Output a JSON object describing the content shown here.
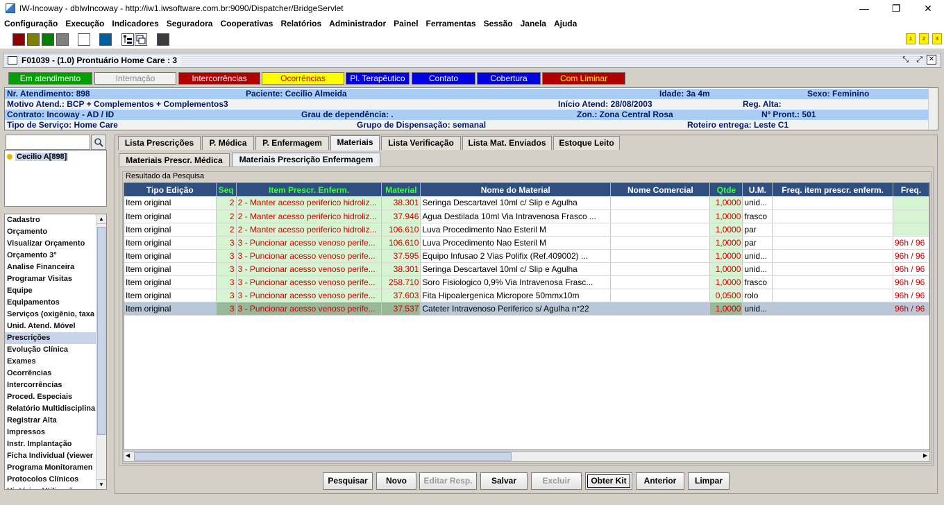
{
  "window": {
    "title": "IW-Incoway - dblwIncoway - http://iw1.iwsoftware.com.br:9090/Dispatcher/BridgeServlet",
    "min": "—",
    "max": "❐",
    "close": "✕"
  },
  "menu": [
    "Configuração",
    "Execução",
    "Indicadores",
    "Seguradora",
    "Cooperativas",
    "Relatórios",
    "Administrador",
    "Painel",
    "Ferramentas",
    "Sessão",
    "Janela",
    "Ajuda"
  ],
  "toolbar": {
    "colors": [
      "#8b0000",
      "#7f7f00",
      "#007f00",
      "#7f7f7f",
      "#ffffff",
      "#005f9f",
      "#3c3c3c"
    ],
    "right_buttons": [
      "1",
      "2",
      "3"
    ]
  },
  "frame": {
    "title": "F01039 - (1.0) Prontuário Home Care : 3"
  },
  "status_buttons": [
    {
      "label": "Em atendimento",
      "bg": "#00a000",
      "fg": "#ffffff"
    },
    {
      "label": "Internação",
      "bg": "#f0f0f0",
      "fg": "#8a8a8a"
    },
    {
      "label": "Intercorrências",
      "bg": "#b00000",
      "fg": "#ffffff"
    },
    {
      "label": "Ocorrências",
      "bg": "#ffff00",
      "fg": "#cc0000"
    },
    {
      "label": "Pl. Terapêutico",
      "bg": "#0000e0",
      "fg": "#ffffff"
    },
    {
      "label": "Contato",
      "bg": "#0000e0",
      "fg": "#ffffff"
    },
    {
      "label": "Cobertura",
      "bg": "#0000e0",
      "fg": "#ffffff"
    },
    {
      "label": "Com Liminar",
      "bg": "#b00000",
      "fg": "#ffff00"
    }
  ],
  "info": {
    "nr_label": "Nr. Atendimento:",
    "nr": "898",
    "paciente_label": "Paciente:",
    "paciente": "Cecilio Almeida",
    "idade_label": "Idade:",
    "idade": "3a 4m",
    "sexo_label": "Sexo:",
    "sexo": "Feminino",
    "motivo_label": "Motivo Atend.:",
    "motivo": "BCP + Complementos + Complementos3",
    "inicio_label": "Início Atend:",
    "inicio": "28/08/2003",
    "alta_label": "Reg. Alta:",
    "alta": "",
    "contrato_label": "Contrato:",
    "contrato": "Incoway - AD / ID",
    "grau_label": "Grau de dependência:",
    "grau": ".",
    "zon_label": "Zon.:",
    "zon": "Zona Central Rosa",
    "pront_label": "Nº Pront.:",
    "pront": "501",
    "tipo_label": "Tipo de Serviço:",
    "tipo": "Home Care",
    "grupo_label": "Grupo de Dispensação:",
    "grupo": "semanal",
    "roteiro_label": "Roteiro entrega:",
    "roteiro": "Leste C1"
  },
  "tree": {
    "item": "Cecilio A[898]"
  },
  "nav": [
    "Cadastro",
    "Orçamento",
    "Visualizar Orçamento",
    "Orçamento 3°",
    "Analise Financeira",
    "Programar Visitas",
    "Equipe",
    "Equipamentos",
    "Serviços (oxigênio, taxa",
    "Unid. Atend. Móvel",
    "Prescrições",
    "Evolução Clínica",
    "Exames",
    "Ocorrências",
    "Intercorrências",
    "Proced. Especiais",
    "Relatório Multidisciplina",
    "Registrar Alta",
    "Impressos",
    "Instr. Implantação",
    "Ficha Individual (viewer",
    "Programa Monitoramen",
    "Protocolos Clínicos",
    "Histórico Utilização"
  ],
  "tabs": [
    "Lista Prescrições",
    "P. Médica",
    "P. Enfermagem",
    "Materiais",
    "Lista Verificação",
    "Lista Mat. Enviados",
    "Estoque Leito"
  ],
  "subtabs": [
    "Materiais Prescr. Médica",
    "Materiais Prescrição Enfermagem"
  ],
  "result_label": "Resultado da Pesquisa",
  "columns": [
    "Tipo Edição",
    "Seq",
    "Item Prescr. Enferm.",
    "Material",
    "Nome do Material",
    "Nome Comercial",
    "Qtde",
    "U.M.",
    "Freq. item prescr. enferm.",
    "Freq."
  ],
  "rows": [
    [
      "Item original",
      "2",
      "2 - Manter acesso periferico hidroliz...",
      "38.301",
      "Seringa Descartavel 10ml c/ Slip e Agulha",
      "",
      "1,0000",
      "unid...",
      "",
      ""
    ],
    [
      "Item original",
      "2",
      "2 - Manter acesso periferico hidroliz...",
      "37.946",
      "Agua Destilada  10ml  Via Intravenosa  Frasco ...",
      "",
      "1,0000",
      "frasco",
      "",
      ""
    ],
    [
      "Item original",
      "2",
      "2 - Manter acesso periferico hidroliz...",
      "106.610",
      "Luva Procedimento Nao Esteril M",
      "",
      "1,0000",
      "par",
      "",
      ""
    ],
    [
      "Item original",
      "3",
      "3 - Puncionar acesso venoso perife...",
      "106.610",
      "Luva Procedimento Nao Esteril M",
      "",
      "1,0000",
      "par",
      "",
      "96h / 96"
    ],
    [
      "Item original",
      "3",
      "3 - Puncionar acesso venoso perife...",
      "37.595",
      "Equipo Infusao 2 Vias Polifix (Ref.409002)         ...",
      "",
      "1,0000",
      "unid...",
      "",
      "96h / 96"
    ],
    [
      "Item original",
      "3",
      "3 - Puncionar acesso venoso perife...",
      "38.301",
      "Seringa Descartavel 10ml c/ Slip e Agulha",
      "",
      "1,0000",
      "unid...",
      "",
      "96h / 96"
    ],
    [
      "Item original",
      "3",
      "3 - Puncionar acesso venoso perife...",
      "258.710",
      "Soro Fisiologico  0,9%  Via Intravenosa  Frasc...",
      "",
      "1,0000",
      "frasco",
      "",
      "96h / 96"
    ],
    [
      "Item original",
      "3",
      "3 - Puncionar acesso venoso perife...",
      "37.603",
      "Fita Hipoalergenica Micropore 50mmx10m",
      "",
      "0,0500",
      "rolo",
      "",
      "96h / 96"
    ],
    [
      "Item original",
      "3",
      "3 - Puncionar acesso venoso perife...",
      "37.537",
      "Cateter Intravenoso Periferico s/ Agulha n°22",
      "",
      "1,0000",
      "unid...",
      "",
      "96h / 96"
    ]
  ],
  "buttons": [
    "Pesquisar",
    "Novo",
    "Editar Resp.",
    "Salvar",
    "Excluir",
    "Obter Kit",
    "Anterior",
    "Limpar"
  ]
}
